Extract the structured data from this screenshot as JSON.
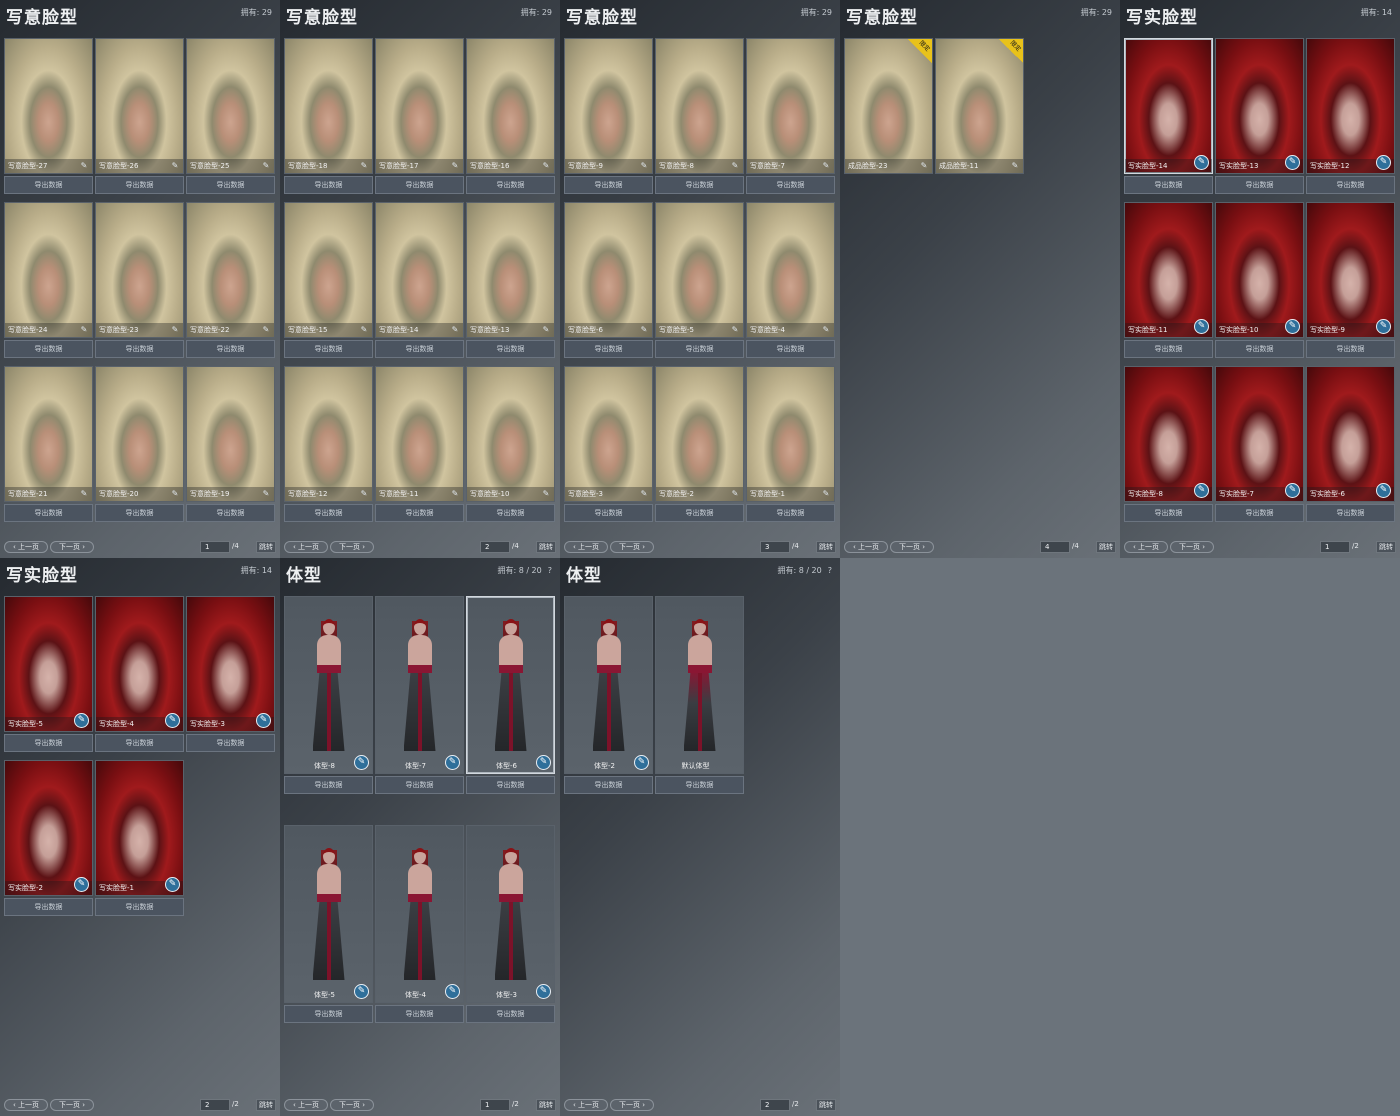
{
  "colors": {
    "page_background": "#6b737b",
    "pen_badge": "#2f6f9a",
    "limited_badge": "#e9c21a"
  },
  "labels": {
    "prev_page": "上一页",
    "next_page": "下一页",
    "go": "跳转",
    "export": "导出数据",
    "help": "?",
    "limited": "限定"
  },
  "panels": [
    {
      "title": "写意脸型",
      "owned": "拥有: 29",
      "page": "1",
      "total": "/4",
      "kind": "blonde",
      "items": [
        "写意脸型-27",
        "写意脸型-26",
        "写意脸型-25",
        "写意脸型-24",
        "写意脸型-23",
        "写意脸型-22",
        "写意脸型-21",
        "写意脸型-20",
        "写意脸型-19"
      ]
    },
    {
      "title": "写意脸型",
      "owned": "拥有: 29",
      "page": "2",
      "total": "/4",
      "kind": "blonde",
      "items": [
        "写意脸型-18",
        "写意脸型-17",
        "写意脸型-16",
        "写意脸型-15",
        "写意脸型-14",
        "写意脸型-13",
        "写意脸型-12",
        "写意脸型-11",
        "写意脸型-10"
      ]
    },
    {
      "title": "写意脸型",
      "owned": "拥有: 29",
      "page": "3",
      "total": "/4",
      "kind": "blonde",
      "items": [
        "写意脸型-9",
        "写意脸型-8",
        "写意脸型-7",
        "写意脸型-6",
        "写意脸型-5",
        "写意脸型-4",
        "写意脸型-3",
        "写意脸型-2",
        "写意脸型-1"
      ]
    },
    {
      "title": "写意脸型",
      "owned": "拥有: 29",
      "page": "4",
      "total": "/4",
      "kind": "blonde",
      "items": [
        "成品脸型-23",
        "成品脸型-11"
      ]
    },
    {
      "title": "写实脸型",
      "owned": "拥有: 14",
      "page": "1",
      "total": "/2",
      "kind": "red",
      "items": [
        "写实脸型-14",
        "写实脸型-13",
        "写实脸型-12",
        "写实脸型-11",
        "写实脸型-10",
        "写实脸型-9",
        "写实脸型-8",
        "写实脸型-7",
        "写实脸型-6"
      ]
    },
    {
      "title": "写实脸型",
      "owned": "拥有: 14",
      "page": "2",
      "total": "/2",
      "kind": "red",
      "items": [
        "写实脸型-5",
        "写实脸型-4",
        "写实脸型-3",
        "写实脸型-2",
        "写实脸型-1"
      ]
    },
    {
      "title": "体型",
      "owned": "拥有: 8 / 20",
      "page": "1",
      "total": "/2",
      "kind": "body",
      "items": [
        "体型-8",
        "体型-7",
        "体型-6",
        "体型-5",
        "体型-4",
        "体型-3"
      ]
    },
    {
      "title": "体型",
      "owned": "拥有: 8 / 20",
      "page": "2",
      "total": "/2",
      "kind": "body",
      "items": [
        "体型-2",
        "默认体型"
      ]
    }
  ]
}
